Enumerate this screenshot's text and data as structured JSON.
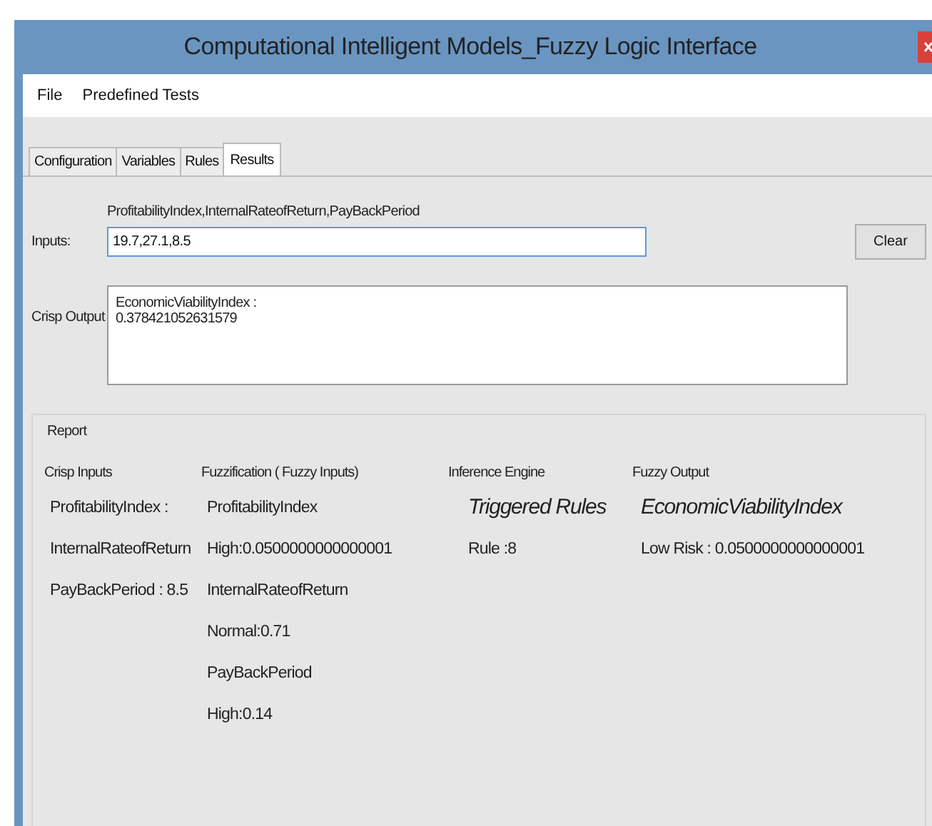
{
  "window": {
    "title": "Computational Intelligent Models_Fuzzy Logic Interface"
  },
  "menu": [
    "File",
    "Predefined Tests"
  ],
  "tabs": [
    {
      "label": "Configuration",
      "selected": false
    },
    {
      "label": "Variables",
      "selected": false
    },
    {
      "label": "Rules",
      "selected": false
    },
    {
      "label": "Results",
      "selected": true
    }
  ],
  "inputs": {
    "hint": "ProfitabilityIndex,InternalRateofReturn,PayBackPeriod",
    "label": "Inputs:",
    "value": "19.7,27.1,8.5"
  },
  "clear_button": "Clear",
  "crisp_output": {
    "label": "Crisp Output",
    "lines": [
      "EconomicViabilityIndex :",
      "0.378421052631579"
    ]
  },
  "report": {
    "title": "Report",
    "columns": [
      {
        "heading": "Crisp Inputs",
        "items": [
          {
            "kind": "value",
            "text": "ProfitabilityIndex :"
          },
          {
            "kind": "value",
            "text": "InternalRateofReturn"
          },
          {
            "kind": "value",
            "text": "PayBackPeriod : 8.5"
          }
        ]
      },
      {
        "heading": "Fuzzification ( Fuzzy Inputs)",
        "items": [
          {
            "kind": "value",
            "text": "ProfitabilityIndex"
          },
          {
            "kind": "value",
            "text": "High:0.0500000000000001"
          },
          {
            "kind": "value",
            "text": "InternalRateofReturn"
          },
          {
            "kind": "value",
            "text": "Normal:0.71"
          },
          {
            "kind": "value",
            "text": "PayBackPeriod"
          },
          {
            "kind": "value",
            "text": "High:0.14"
          }
        ]
      },
      {
        "heading": "Inference Engine",
        "items": [
          {
            "kind": "title",
            "text": "Triggered Rules"
          },
          {
            "kind": "value",
            "text": "Rule :8"
          }
        ]
      },
      {
        "heading": "Fuzzy Output",
        "items": [
          {
            "kind": "title",
            "text": "EconomicViabilityIndex"
          },
          {
            "kind": "value",
            "text": "Low Risk : 0.0500000000000001"
          }
        ]
      }
    ]
  }
}
